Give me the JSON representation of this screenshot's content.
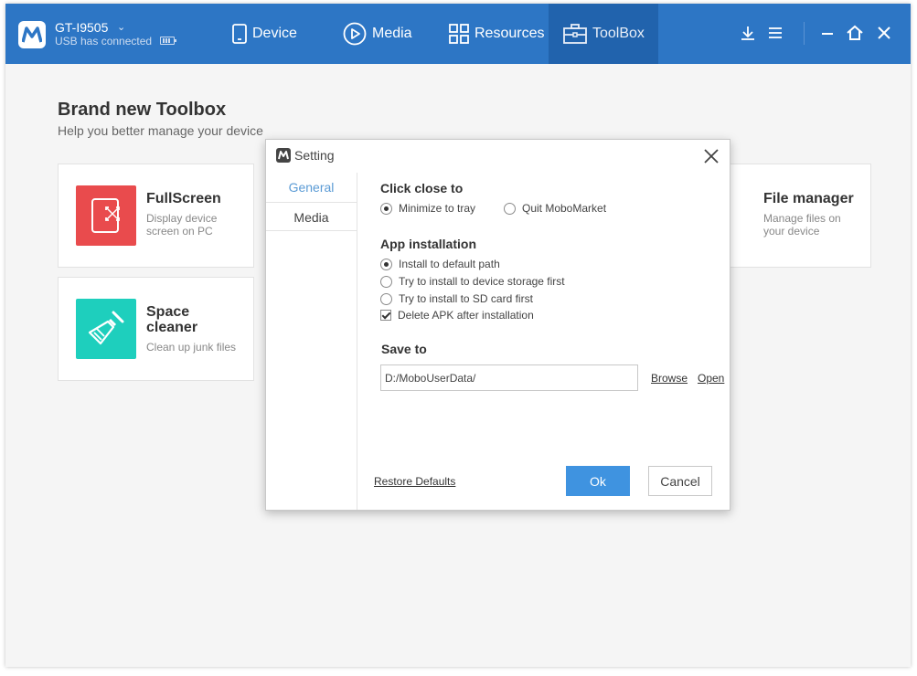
{
  "device": {
    "name": "GT-I9505",
    "status": "USB has connected"
  },
  "nav": {
    "device": "Device",
    "media": "Media",
    "resources": "Resources",
    "toolbox": "ToolBox"
  },
  "colors": {
    "topbar": "#2d76c5",
    "topbar_active": "#2163ad",
    "fullscreen": "#e94b4d",
    "space_cleaner": "#1ecfbd",
    "file_manager": "#f5bb05",
    "ok_button": "#3f93e0",
    "selected_tab": "#5b9bd5"
  },
  "page": {
    "title": "Brand new Toolbox",
    "subtitle": "Help you better manage your device"
  },
  "tools": {
    "fullscreen": {
      "title": "FullScreen",
      "desc_line1": "Display device",
      "desc_line2": "screen on PC"
    },
    "space_cleaner": {
      "title_line1": "Space",
      "title_line2": "cleaner",
      "desc": "Clean up junk files"
    },
    "file_manager": {
      "title": "File manager",
      "desc_line1": "Manage files on",
      "desc_line2": "your device"
    }
  },
  "dialog": {
    "title": "Setting",
    "tabs": {
      "general": "General",
      "media": "Media"
    },
    "click_close": {
      "title": "Click close to",
      "options": [
        "Minimize to tray",
        "Quit MoboMarket"
      ],
      "selected": "Minimize to tray"
    },
    "app_install": {
      "title": "App installation",
      "options": [
        "Install to default path",
        "Try to install to device storage first",
        "Try to install to SD card first"
      ],
      "selected": "Install to default path",
      "delete_apk_label": "Delete APK after installation",
      "delete_apk_checked": true
    },
    "save_to": {
      "title": "Save to",
      "path": "D:/MoboUserData/",
      "browse": "Browse",
      "open": "Open"
    },
    "restore_defaults": "Restore Defaults",
    "ok": "Ok",
    "cancel": "Cancel"
  }
}
